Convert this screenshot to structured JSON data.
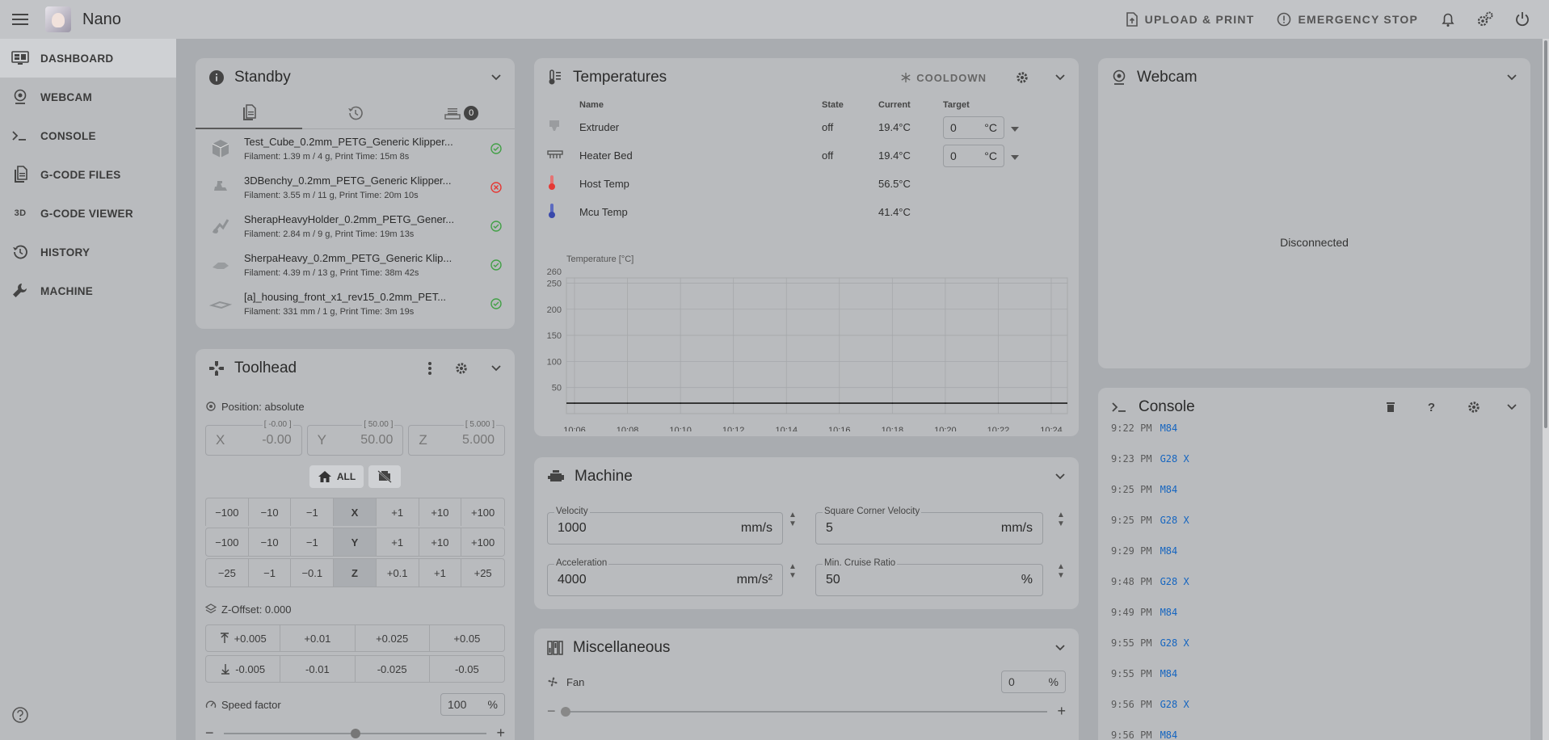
{
  "app": {
    "title": "Nano"
  },
  "topbar": {
    "upload_label": "UPLOAD & PRINT",
    "estop_label": "EMERGENCY STOP"
  },
  "nav": [
    {
      "label": "DASHBOARD",
      "icon": "monitor-dashboard-icon"
    },
    {
      "label": "WEBCAM",
      "icon": "webcam-icon"
    },
    {
      "label": "CONSOLE",
      "icon": "console-icon"
    },
    {
      "label": "G-CODE FILES",
      "icon": "file-document-icon"
    },
    {
      "label": "G-CODE VIEWER",
      "icon": "3d-icon",
      "icon_text": "3D"
    },
    {
      "label": "HISTORY",
      "icon": "history-icon"
    },
    {
      "label": "MACHINE",
      "icon": "wrench-icon"
    }
  ],
  "standby": {
    "title": "Standby",
    "queue_count": "0",
    "files": [
      {
        "name": "Test_Cube_0.2mm_PETG_Generic Klipper...",
        "meta": "Filament: 1.39 m / 4 g, Print Time: 15m 8s",
        "status": "ok"
      },
      {
        "name": "3DBenchy_0.2mm_PETG_Generic Klipper...",
        "meta": "Filament: 3.55 m / 11 g, Print Time: 20m 10s",
        "status": "error"
      },
      {
        "name": "SherapHeavyHolder_0.2mm_PETG_Gener...",
        "meta": "Filament: 2.84 m / 9 g, Print Time: 19m 13s",
        "status": "ok"
      },
      {
        "name": "SherpaHeavy_0.2mm_PETG_Generic Klip...",
        "meta": "Filament: 4.39 m / 13 g, Print Time: 38m 42s",
        "status": "ok"
      },
      {
        "name": "[a]_housing_front_x1_rev15_0.2mm_PET...",
        "meta": "Filament: 331 mm / 1 g, Print Time: 3m 19s",
        "status": "ok"
      }
    ]
  },
  "toolhead": {
    "title": "Toolhead",
    "position_label": "Position: absolute",
    "x": {
      "label": "X",
      "value": "-0.00",
      "top": "[ -0.00 ]"
    },
    "y": {
      "label": "Y",
      "value": "50.00",
      "top": "[ 50.00 ]"
    },
    "z": {
      "label": "Z",
      "value": "5.000",
      "top": "[ 5.000 ]"
    },
    "home_all": "ALL",
    "jog_rows": [
      [
        "−100",
        "−10",
        "−1",
        "X",
        "+1",
        "+10",
        "+100"
      ],
      [
        "−100",
        "−10",
        "−1",
        "Y",
        "+1",
        "+10",
        "+100"
      ],
      [
        "−25",
        "−1",
        "−0.1",
        "Z",
        "+0.1",
        "+1",
        "+25"
      ]
    ],
    "zoffset_label": "Z-Offset: 0.000",
    "zoffset_up": [
      "+0.005",
      "+0.01",
      "+0.025",
      "+0.05"
    ],
    "zoffset_down": [
      "-0.005",
      "-0.01",
      "-0.025",
      "-0.05"
    ],
    "speed_label": "Speed factor",
    "speed_value": "100",
    "speed_unit": "%",
    "speed_fraction": 0.5
  },
  "temperatures": {
    "title": "Temperatures",
    "cooldown_label": "COOLDOWN",
    "headers": [
      "Name",
      "State",
      "Current",
      "Target"
    ],
    "rows": [
      {
        "name": "Extruder",
        "state": "off",
        "current": "19.4°C",
        "target": "0",
        "unit": "°C"
      },
      {
        "name": "Heater Bed",
        "state": "off",
        "current": "19.4°C",
        "target": "0",
        "unit": "°C"
      },
      {
        "name": "Host Temp",
        "state": "",
        "current": "56.5°C"
      },
      {
        "name": "Mcu Temp",
        "state": "",
        "current": "41.4°C"
      }
    ]
  },
  "chart_data": {
    "type": "line",
    "ylabel": "Temperature [°C]",
    "y_ticks": [
      50,
      100,
      150,
      200,
      250
    ],
    "y_top_label": "260",
    "ylim": [
      0,
      260
    ],
    "x": [
      "10:06",
      "10:08",
      "10:10",
      "10:12",
      "10:14",
      "10:16",
      "10:18",
      "10:20",
      "10:22",
      "10:24"
    ],
    "series": [
      {
        "values": [
          20,
          20,
          20,
          20,
          20,
          20,
          20,
          20,
          20,
          20
        ]
      }
    ],
    "grid": true
  },
  "machine": {
    "title": "Machine",
    "velocity": {
      "label": "Velocity",
      "value": "1000",
      "unit": "mm/s"
    },
    "scv": {
      "label": "Square Corner Velocity",
      "value": "5",
      "unit": "mm/s"
    },
    "accel": {
      "label": "Acceleration",
      "value": "4000",
      "unit": "mm/s²"
    },
    "cruise": {
      "label": "Min. Cruise Ratio",
      "value": "50",
      "unit": "%"
    }
  },
  "misc": {
    "title": "Miscellaneous",
    "fan_label": "Fan",
    "fan_value": "0",
    "fan_unit": "%",
    "fan_fraction": 0
  },
  "webcam": {
    "title": "Webcam",
    "status": "Disconnected"
  },
  "console": {
    "title": "Console",
    "lines": [
      {
        "time": "9:22 PM",
        "cmd": "M84"
      },
      {
        "time": "9:23 PM",
        "cmd": "G28 X"
      },
      {
        "time": "9:25 PM",
        "cmd": "M84"
      },
      {
        "time": "9:25 PM",
        "cmd": "G28 X"
      },
      {
        "time": "9:29 PM",
        "cmd": "M84"
      },
      {
        "time": "9:48 PM",
        "cmd": "G28 X"
      },
      {
        "time": "9:49 PM",
        "cmd": "M84"
      },
      {
        "time": "9:55 PM",
        "cmd": "G28 X"
      },
      {
        "time": "9:55 PM",
        "cmd": "M84"
      },
      {
        "time": "9:56 PM",
        "cmd": "G28 X"
      },
      {
        "time": "9:56 PM",
        "cmd": "M84"
      }
    ]
  }
}
